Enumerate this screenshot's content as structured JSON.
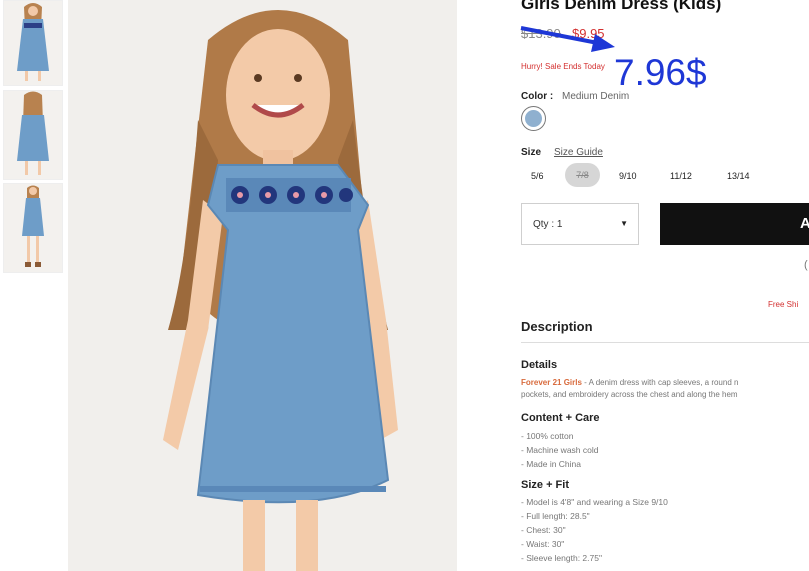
{
  "product": {
    "title": "Girls Denim Dress (Kids)",
    "price_original": "$13.90",
    "price_sale": "$9.95",
    "sale_note": "Hurry! Sale Ends Today",
    "annotation_price": "7.96$"
  },
  "color": {
    "label": "Color :",
    "value": "Medium Denim",
    "swatch_color": "#8fb0cf"
  },
  "size": {
    "label": "Size",
    "guide_link": "Size Guide",
    "options": [
      "5/6",
      "7/8",
      "9/10",
      "11/12",
      "13/14"
    ],
    "unavailable": "7/8"
  },
  "purchase": {
    "qty_label": "Qty : 1",
    "add_button_label": "A",
    "stray_text": "(",
    "free_shipping": "Free Shi"
  },
  "description": {
    "title": "Description",
    "details_heading": "Details",
    "details_brand": "Forever 21 Girls",
    "details_line1": " - A denim dress with cap sleeves, a round n",
    "details_line2": "pockets, and embroidery across the chest and along the hem",
    "content_heading": "Content + Care",
    "content_items": [
      "- 100% cotton",
      "- Machine wash cold",
      "- Made in China"
    ],
    "fit_heading": "Size + Fit",
    "fit_items": [
      "- Model is 4'8\" and wearing a Size 9/10",
      "- Full length: 28.5\"",
      "- Chest: 30\"",
      "- Waist: 30\"",
      "- Sleeve length: 2.75\""
    ]
  },
  "colors": {
    "sale_red": "#d32f2f",
    "annotation_blue": "#1e37d6",
    "button_black": "#111111"
  }
}
